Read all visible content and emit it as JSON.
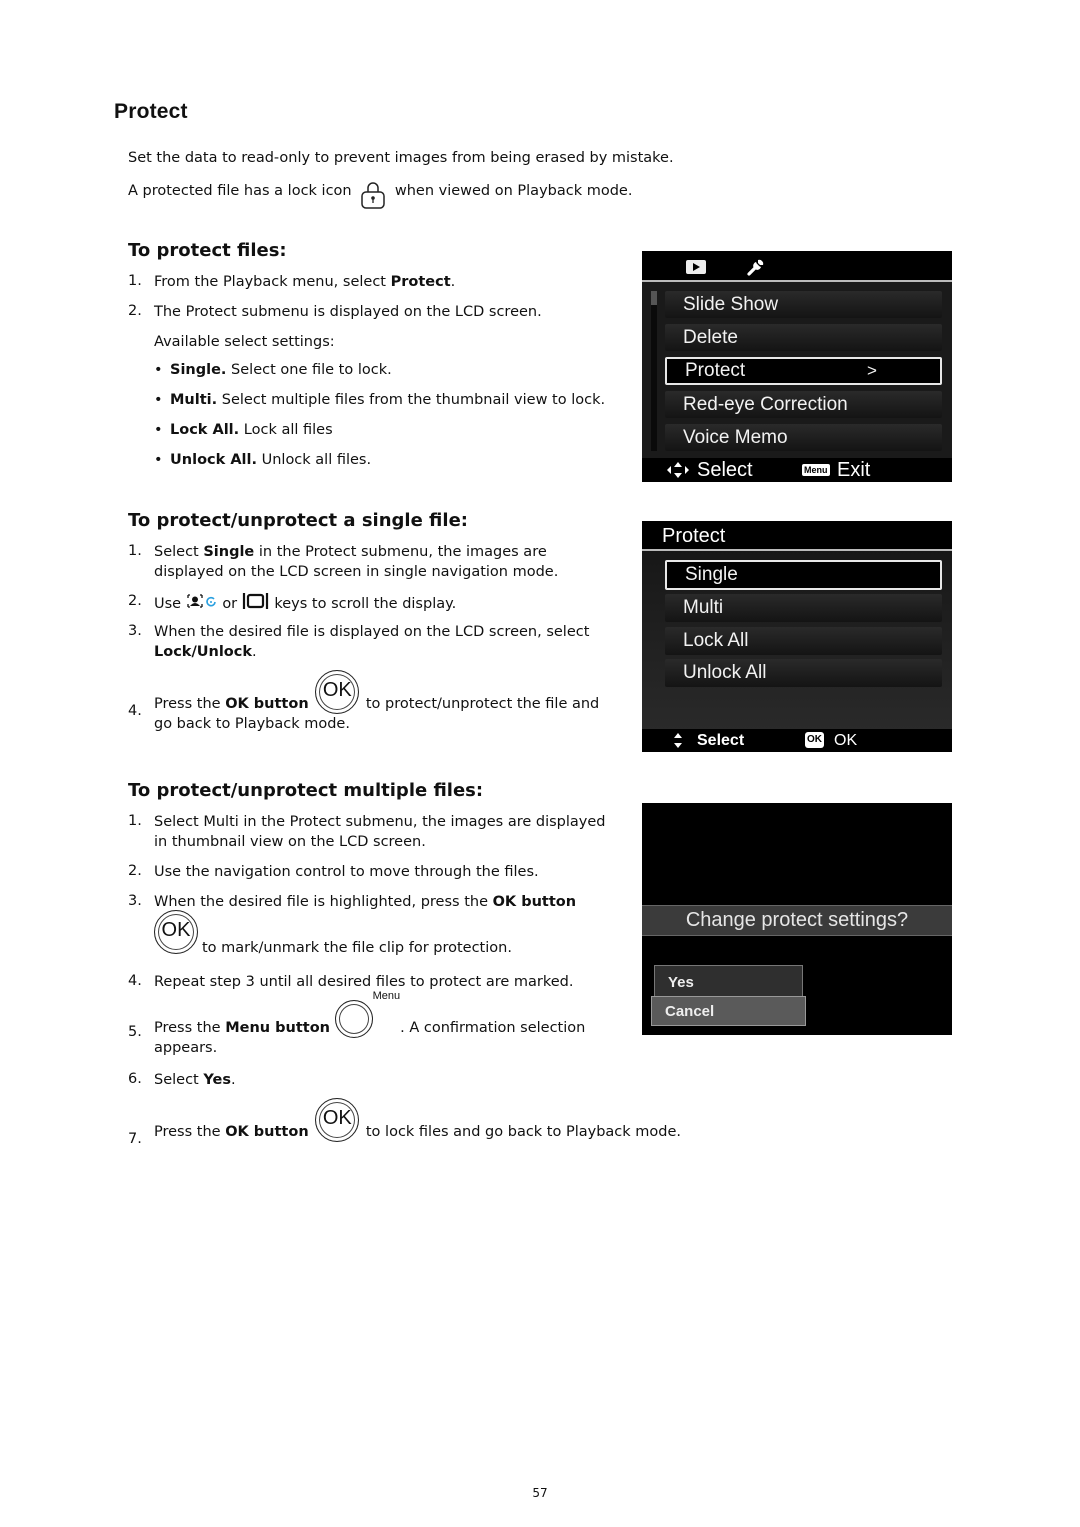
{
  "page_title": "Protect",
  "intro": {
    "line1": "Set the data to read-only to prevent images from being erased by mistake.",
    "line2_before": "A protected file has a lock icon",
    "line2_icon": "lock-icon",
    "line2_after": "when viewed on Playback mode."
  },
  "section1": {
    "heading": "To protect files:",
    "steps": [
      {
        "n": "1.",
        "text_before": "From the Playback menu, select ",
        "bold": "Protect",
        "text_after": "."
      },
      {
        "n": "2.",
        "text": "The Protect submenu is displayed on the LCD screen."
      }
    ],
    "available_label": "Available select settings:",
    "bullets": [
      {
        "bold": "Single.",
        "text": " Select one file to lock."
      },
      {
        "bold": "Multi.",
        "text": " Select multiple files from the thumbnail view to lock."
      },
      {
        "bold": "Lock All.",
        "text": " Lock all files"
      },
      {
        "bold": "Unlock All.",
        "text": " Unlock all files."
      }
    ]
  },
  "section2": {
    "heading": "To protect/unprotect a single file:",
    "step1": {
      "n": "1.",
      "before": "Select ",
      "bold": "Single",
      "after": " in the Protect submenu, the images are",
      "line2": "displayed on the LCD screen in single navigation mode."
    },
    "step2": {
      "n": "2.",
      "before": "Use",
      "mid": "or",
      "after": "keys to scroll the display.",
      "icon_a": "face-detect-rotate-icon",
      "icon_b": "display-icon"
    },
    "step3": {
      "n": "3.",
      "text": "When the desired file is displayed on the LCD screen, select",
      "bold": "Lock/Unlock",
      "after": "."
    },
    "step4": {
      "n": "4.",
      "before": "Press the ",
      "bold": "OK button",
      "after": "to protect/unprotect the file and",
      "line2": "go back to Playback mode.",
      "button_label": "OK"
    }
  },
  "section3": {
    "heading": "To protect/unprotect multiple files:",
    "step1": {
      "n": "1.",
      "text": "Select Multi in the Protect submenu, the images are displayed",
      "line2": "in thumbnail view on the LCD screen."
    },
    "step2": {
      "n": "2.",
      "text": "Use the navigation control to move through the files."
    },
    "step3": {
      "n": "3.",
      "before": "When the desired file is highlighted, press the ",
      "bold": "OK button",
      "after": "to mark/unmark the file clip for protection.",
      "button_label": "OK"
    },
    "step4": {
      "n": "4.",
      "text": "Repeat step 3 until all desired files to protect are marked."
    },
    "step5": {
      "n": "5.",
      "before": "Press the ",
      "bold": "Menu button",
      "sup": "Menu",
      "after": ". A confirmation selection",
      "line2": "appears."
    },
    "step6": {
      "n": "6.",
      "before": "Select ",
      "bold": "Yes",
      "after": "."
    },
    "step7": {
      "n": "7.",
      "before": "Press the ",
      "bold": "OK button",
      "after": "to lock files and go back to Playback mode.",
      "button_label": "OK"
    }
  },
  "lcd_playback_menu": {
    "tabs": [
      "playback-icon",
      "wrench-icon"
    ],
    "items": [
      "Slide Show",
      "Delete",
      "Protect",
      "Red-eye Correction",
      "Voice Memo"
    ],
    "selected_index": 2,
    "selected_arrow": ">",
    "footer_left": "Select",
    "footer_right_badge": "Menu",
    "footer_right": "Exit"
  },
  "lcd_protect_menu": {
    "title": "Protect",
    "items": [
      "Single",
      "Multi",
      "Lock All",
      "Unlock All"
    ],
    "selected_index": 0,
    "footer_left": "Select",
    "footer_right_badge": "OK",
    "footer_right": "OK"
  },
  "lcd_confirm": {
    "question": "Change protect settings?",
    "options": [
      "Yes",
      "Cancel"
    ],
    "selected_index": 1
  },
  "page_number": "57"
}
